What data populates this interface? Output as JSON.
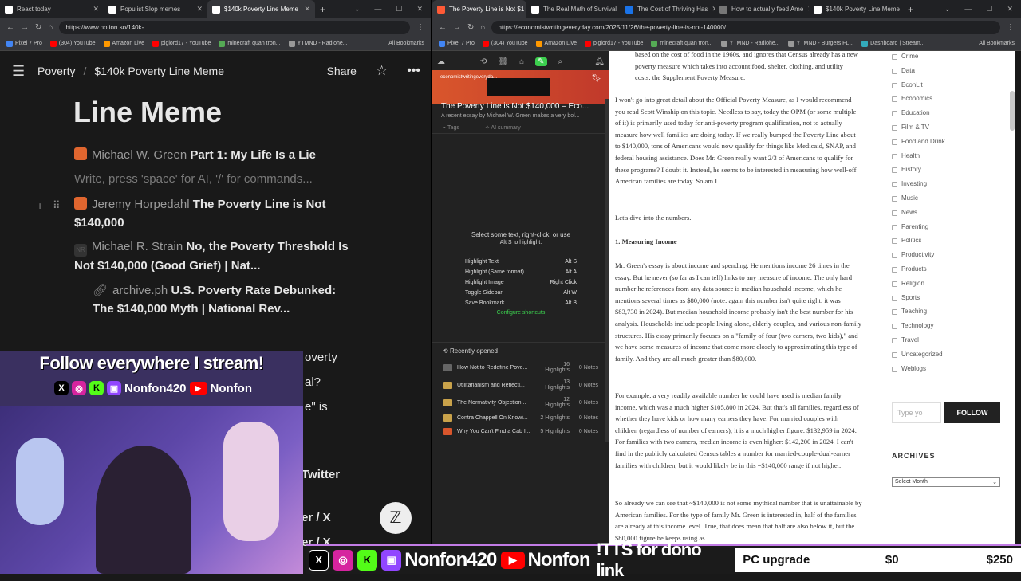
{
  "left_tabs": [
    {
      "label": "React today",
      "color": "#ffffff"
    },
    {
      "label": "Populist Slop memes",
      "color": "#ffffff"
    },
    {
      "label": "$140k Poverty Line Meme",
      "color": "#ffffff",
      "active": true
    }
  ],
  "left_url": "https://www.notion.so/140k-...",
  "right_tabs": [
    {
      "label": "The Poverty Line is Not $1",
      "color": "#ff5a36",
      "active": true
    },
    {
      "label": "The Real Math of Survival",
      "color": "#ffffff"
    },
    {
      "label": "The Cost of Thriving Has",
      "color": "#1a73e8"
    },
    {
      "label": "How to actually feed Ame",
      "color": "#777777"
    },
    {
      "label": "$140k Poverty Line Meme",
      "color": "#ffffff"
    }
  ],
  "right_url": "https://economistwritingeveryday.com/2025/11/26/the-poverty-line-is-not-140000/",
  "left_bookmarks": [
    "Pixel 7 Pro",
    "(304) YouTube",
    "Amazon Live",
    "pigiord17 - YouTube",
    "minecraft quan tron...",
    "YTMND - Radiohe...",
    "All Bookmarks"
  ],
  "right_bookmarks": [
    "Pixel 7 Pro",
    "(304) YouTube",
    "Amazon Live",
    "pigiord17 - YouTube",
    "minecraft quan tron...",
    "YTMND - Radiohe...",
    "YTMND - Burgers FL...",
    "Dashboard | Stream...",
    "All Bookmarks"
  ],
  "notion": {
    "breadcrumb_parent": "Poverty",
    "breadcrumb_page": "$140k Poverty Line Meme",
    "share": "Share",
    "title": "Line Meme",
    "items": [
      {
        "author": "Michael W. Green",
        "title": "Part 1: My Life Is a Lie",
        "icon_color": "#e0662f"
      },
      {
        "placeholder": "Write, press 'space' for AI, '/' for commands..."
      },
      {
        "author": "Jeremy Horpedahl",
        "title": "The Poverty Line is Not",
        "title2": "$140,000",
        "icon_color": "#e0662f"
      },
      {
        "author": "Michael R. Strain",
        "title": "No, the Poverty Threshold Is",
        "title2": "Not $140,000 (Good Grief) | Nat...",
        "icon_label": "NR"
      },
      {
        "author": "archive.ph",
        "title": "U.S. Poverty Rate Debunked:",
        "title2": "The $140,000 Myth | National Rev..."
      }
    ],
    "partial": [
      "overty",
      "al?",
      "e\" is",
      "Twitter",
      "er / X",
      "er / X"
    ]
  },
  "reader": {
    "site": "economistwritingeveryda...",
    "title": "The Poverty Line is Not $140,000 – Eco...",
    "subtitle": "A recent essay by Michael W. Green makes a very bol...",
    "tags": "Tags",
    "ai_summary": "AI summary",
    "hint1": "Select some text, right-click, or use",
    "hint2": "Alt  S  to highlight.",
    "shortcuts": [
      {
        "label": "Highlight Text",
        "key": "Alt  S"
      },
      {
        "label": "Highlight (Same format)",
        "key": "Alt  A"
      },
      {
        "label": "Highlight Image",
        "key": "Right Click"
      },
      {
        "label": "Toggle Sidebar",
        "key": "Alt  W"
      },
      {
        "label": "Save Bookmark",
        "key": "Alt  B"
      }
    ],
    "configure": "Configure shortcuts",
    "recent_title": "Recently opened",
    "recent": [
      {
        "title": "How Not to Redefine Pove...",
        "meta": "16 Highlights",
        "notes": "0 Notes"
      },
      {
        "title": "Utilitarianism and Reflecti...",
        "meta": "13 Highlights",
        "notes": "0 Notes"
      },
      {
        "title": "The Normativity Objection...",
        "meta": "12 Highlights",
        "notes": "0 Notes"
      },
      {
        "title": "Contra Chappell On Knowi...",
        "meta": "2 Highlights",
        "notes": "0 Notes"
      },
      {
        "title": "Why You Can't Find a Cab I...",
        "meta": "5 Highlights",
        "notes": "0 Notes"
      }
    ]
  },
  "article": {
    "p0": "based on the cost of food in the 1960s, and ignores that Census already has a new poverty measure which takes into account food, shelter, clothing, and utility costs: the Supplement Poverty Measure.",
    "p1": "I won't go into great detail about the Official Poverty Measure, as I would recommend you read Scott Winship on this topic. Needless to say, today the OPM (or some multiple of it) is primarily used today for anti-poverty program qualification, not to actually measure how well families are doing today. If we really bumped the Poverty Line about to $140,000, tons of Americans would now qualify for things like Medicaid, SNAP, and federal housing assistance. Does Mr. Green really want 2/3 of Americans to qualify for these programs? I doubt it. Instead, he seems to be interested in measuring how well-off American families are today. So am I.",
    "p2": "Let's dive into the numbers.",
    "h1": "1. Measuring Income",
    "p3": "Mr. Green's essay is about income and spending. He mentions income 26 times in the essay. But he never (so far as I can tell) links to any measure of income. The only hard number he references from any data source is median household income, which he mentions several times as $80,000 (note: again this number isn't quite right: it was $83,730 in 2024). But median household income probably isn't the best number for his analysis. Households include people living alone, elderly couples, and various non-family structures. His essay primarily focuses on a \"family of four (two earners, two kids),\" and we have some measures of income that come more closely to approximating this type of family. And they are all much greater than $80,000.",
    "p4": "For example, a very readily available number he could have used is median family income, which was a much higher $105,800 in 2024. But that's all families, regardless of whether they have kids or how many earners they have. For married couples with children (regardless of number of earners), it is a much higher figure: $132,959 in 2024. For families with two earners, median income is even higher: $142,200 in 2024. I can't find in the publicly calculated Census tables a number for married-couple-dual-earner families with children, but it would likely be in this ~$140,000 range if not higher.",
    "p5": "So already we can see that ~$140,000 is not some mythical number that is unattainable by American families. For the type of family Mr. Green is interested in, half of the families are already at this income level. True, that does mean that half are also below it, but the $80,000 figure he keeps using as"
  },
  "sidebar": {
    "categories": [
      "Crime",
      "Data",
      "EconLit",
      "Economics",
      "Education",
      "Film & TV",
      "Food and Drink",
      "Health",
      "History",
      "Investing",
      "Music",
      "News",
      "Parenting",
      "Politics",
      "Productivity",
      "Products",
      "Religion",
      "Sports",
      "Teaching",
      "Technology",
      "Travel",
      "Uncategorized",
      "Weblogs"
    ],
    "email_placeholder": "Type yo",
    "follow": "FOLLOW",
    "archives": "ARCHIVES",
    "select_month": "Select Month"
  },
  "overlay": {
    "follow": "Follow everywhere I stream!",
    "handle1": "Nonfon420",
    "handle2": "Nonfon",
    "tts": "!TTS for dono link",
    "goal_label": "PC upgrade",
    "goal_current": "$0",
    "goal_target": "$250"
  }
}
